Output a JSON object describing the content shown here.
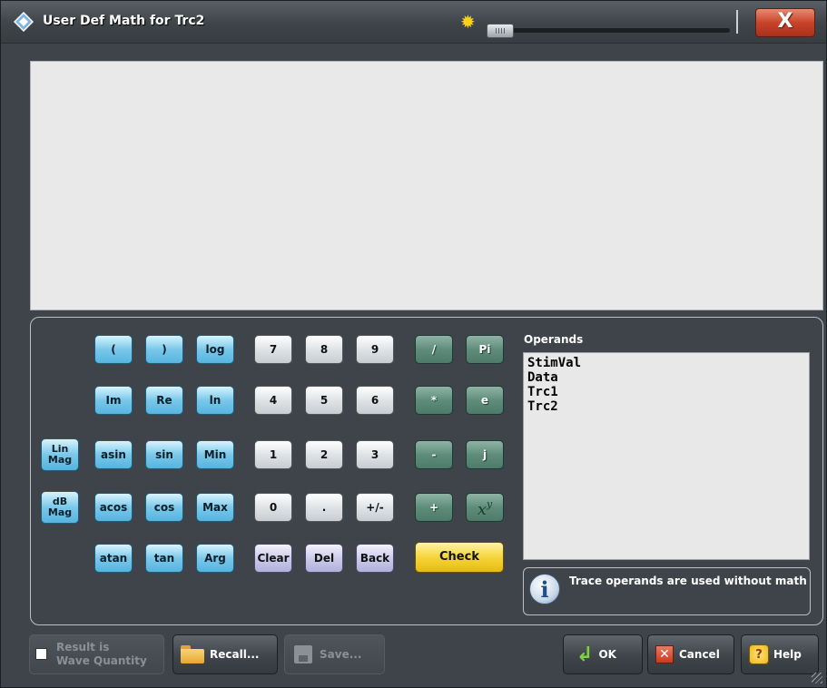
{
  "window": {
    "title": "User Def Math for Trc2",
    "brightness_icon": "sun-icon",
    "brightness_level": 0.0,
    "close_label": "X"
  },
  "editor": {
    "value": ""
  },
  "keypad": {
    "functions": [
      {
        "key": "open-paren",
        "label": "("
      },
      {
        "key": "close-paren",
        "label": ")"
      },
      {
        "key": "log",
        "label": "log"
      },
      {
        "key": "im",
        "label": "Im"
      },
      {
        "key": "re",
        "label": "Re"
      },
      {
        "key": "ln",
        "label": "ln"
      },
      {
        "key": "lin-mag",
        "label": "Lin\nMag"
      },
      {
        "key": "asin",
        "label": "asin"
      },
      {
        "key": "sin",
        "label": "sin"
      },
      {
        "key": "min",
        "label": "Min"
      },
      {
        "key": "db-mag",
        "label": "dB\nMag"
      },
      {
        "key": "acos",
        "label": "acos"
      },
      {
        "key": "cos",
        "label": "cos"
      },
      {
        "key": "max",
        "label": "Max"
      },
      {
        "key": "atan",
        "label": "atan"
      },
      {
        "key": "tan",
        "label": "tan"
      },
      {
        "key": "arg",
        "label": "Arg"
      }
    ],
    "digits": [
      "7",
      "8",
      "9",
      "4",
      "5",
      "6",
      "1",
      "2",
      "3",
      "0",
      ".",
      "+/-"
    ],
    "edit": {
      "clear": "Clear",
      "del": "Del",
      "back": "Back"
    },
    "operators": {
      "divide": "/",
      "pi": "Pi",
      "multiply": "*",
      "e": "e",
      "minus": "-",
      "j": "j",
      "plus": "+",
      "power_base": "x",
      "power_exp": "y"
    },
    "check": "Check"
  },
  "operands": {
    "label": "Operands",
    "items": [
      "StimVal",
      "Data",
      "Trc1",
      "Trc2"
    ]
  },
  "info": {
    "icon": "info-icon",
    "text": "Trace operands are used without math"
  },
  "footer": {
    "result_is_wave": {
      "label_line1": "Result is",
      "label_line2": "Wave Quantity",
      "checked": false
    },
    "recall": "Recall...",
    "save": "Save...",
    "ok": "OK",
    "cancel": "Cancel",
    "help": "Help"
  }
}
